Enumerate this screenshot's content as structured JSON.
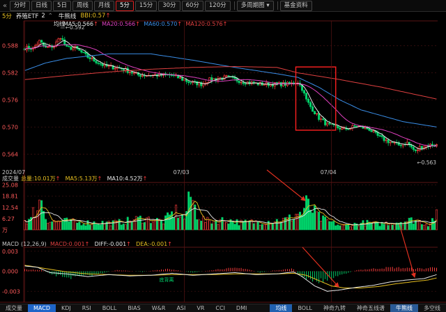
{
  "toolbar": {
    "back_glyph": "«",
    "buttons": [
      "分时",
      "日线",
      "5日",
      "周线",
      "月线",
      "5分",
      "15分",
      "30分",
      "60分",
      "120分"
    ],
    "active": "5分",
    "dropdown": "多周期图 ▾",
    "basic": "基金资料"
  },
  "info": {
    "period": "5分",
    "name": "养殖ETF",
    "count": "2",
    "toggle": "⌃",
    "indicator": "牛熊线",
    "bbi": "BBI:0.57",
    "bbi_arrow": "↑"
  },
  "chart_data": [
    {
      "type": "candlestick",
      "ma_legend": {
        "name": "均线"
      },
      "legend": [
        {
          "label": "MA5:0.566",
          "arrow": "↑",
          "color": "#e8e8e8"
        },
        {
          "label": "MA20:0.566",
          "arrow": "↑",
          "color": "#e040c0"
        },
        {
          "label": "MA60:0.570",
          "arrow": "↑",
          "color": "#3a8ee8"
        },
        {
          "label": "MA120:0.576",
          "arrow": "↑",
          "color": "#e04040"
        }
      ],
      "yticks": [
        "0.588",
        "0.582",
        "0.576",
        "0.570",
        "0.564"
      ],
      "ylim": [
        0.5605,
        0.5935
      ],
      "high_label": "0.592",
      "low_label": "0.563",
      "x_labels": [
        "2024/07",
        "07/03",
        "07/04"
      ],
      "x_label_pos": [
        0,
        76,
        146
      ],
      "n_bars": 197,
      "anchors": [
        [
          0,
          0.5875
        ],
        [
          4,
          0.5875
        ],
        [
          7,
          0.589
        ],
        [
          10,
          0.5875
        ],
        [
          14,
          0.588
        ],
        [
          17,
          0.59
        ],
        [
          20,
          0.5875
        ],
        [
          24,
          0.5875
        ],
        [
          30,
          0.5855
        ],
        [
          38,
          0.5835
        ],
        [
          46,
          0.583
        ],
        [
          54,
          0.5815
        ],
        [
          62,
          0.5815
        ],
        [
          70,
          0.5815
        ],
        [
          78,
          0.58
        ],
        [
          84,
          0.5795
        ],
        [
          88,
          0.5805
        ],
        [
          96,
          0.581
        ],
        [
          104,
          0.58
        ],
        [
          112,
          0.5795
        ],
        [
          120,
          0.5795
        ],
        [
          126,
          0.5795
        ],
        [
          130,
          0.58
        ],
        [
          132,
          0.5785
        ],
        [
          134,
          0.576
        ],
        [
          136,
          0.5745
        ],
        [
          140,
          0.572
        ],
        [
          144,
          0.5705
        ],
        [
          148,
          0.57
        ],
        [
          152,
          0.5695
        ],
        [
          158,
          0.5702
        ],
        [
          164,
          0.5695
        ],
        [
          168,
          0.568
        ],
        [
          172,
          0.567
        ],
        [
          178,
          0.566
        ],
        [
          182,
          0.5665
        ],
        [
          186,
          0.5645
        ],
        [
          188,
          0.5655
        ],
        [
          192,
          0.566
        ],
        [
          196,
          0.566
        ]
      ],
      "ma60": [
        [
          0,
          0.5825
        ],
        [
          10,
          0.5842
        ],
        [
          20,
          0.5852
        ],
        [
          40,
          0.5862
        ],
        [
          60,
          0.5862
        ],
        [
          80,
          0.5848
        ],
        [
          100,
          0.5832
        ],
        [
          120,
          0.5818
        ],
        [
          130,
          0.581
        ],
        [
          140,
          0.5788
        ],
        [
          150,
          0.576
        ],
        [
          160,
          0.5738
        ],
        [
          170,
          0.5725
        ],
        [
          180,
          0.5712
        ],
        [
          196,
          0.57
        ]
      ],
      "ma120": [
        [
          0,
          0.5805
        ],
        [
          20,
          0.5814
        ],
        [
          40,
          0.5822
        ],
        [
          60,
          0.5828
        ],
        [
          80,
          0.5832
        ],
        [
          100,
          0.5834
        ],
        [
          120,
          0.5832
        ],
        [
          130,
          0.582
        ],
        [
          150,
          0.5805
        ],
        [
          170,
          0.5788
        ],
        [
          196,
          0.5762
        ]
      ],
      "box": {
        "x0": 129,
        "x1": 148,
        "y0": 0.5833,
        "y1": 0.5693
      }
    },
    {
      "type": "bar",
      "title": "成交量",
      "legend": [
        {
          "label": "总量:10.01万",
          "arrow": "↑",
          "color": "#e8c020"
        },
        {
          "label": "MA5:5.13万",
          "arrow": "↑",
          "color": "#e8c020"
        },
        {
          "label": "MA10:4.52万",
          "arrow": "↑",
          "color": "#e8e8e8"
        }
      ],
      "yticks": [
        "25.08",
        "18.81",
        "12.54",
        "6.27",
        "万"
      ],
      "ylim": [
        0,
        26.5
      ],
      "peaks": [
        [
          3,
          7
        ],
        [
          4,
          12
        ],
        [
          6,
          16
        ],
        [
          8,
          22
        ],
        [
          10,
          9
        ],
        [
          12,
          6
        ],
        [
          20,
          6
        ],
        [
          26,
          5
        ],
        [
          44,
          5
        ],
        [
          56,
          8
        ],
        [
          66,
          6
        ],
        [
          72,
          13
        ],
        [
          76,
          8
        ],
        [
          79,
          24
        ],
        [
          82,
          11
        ],
        [
          86,
          6
        ],
        [
          96,
          7
        ],
        [
          103,
          5
        ],
        [
          116,
          6
        ],
        [
          124,
          7
        ],
        [
          128,
          9
        ],
        [
          130,
          12
        ],
        [
          132,
          11
        ],
        [
          134,
          18
        ],
        [
          136,
          15
        ],
        [
          138,
          12
        ],
        [
          140,
          9
        ],
        [
          142,
          7
        ],
        [
          144,
          6
        ],
        [
          150,
          3
        ],
        [
          158,
          4
        ],
        [
          162,
          5
        ],
        [
          168,
          4
        ],
        [
          174,
          5
        ],
        [
          180,
          6
        ],
        [
          186,
          7
        ],
        [
          192,
          4
        ],
        [
          196,
          10
        ]
      ]
    },
    {
      "type": "bar",
      "title": "MACD",
      "params": "(12,26,9)",
      "legend": [
        {
          "label": "MACD:0.001",
          "arrow": "↑",
          "color": "#e04040"
        },
        {
          "label": "DIFF:-0.001",
          "arrow": "↑",
          "color": "#e8e8e8"
        },
        {
          "label": "DEA:-0.001",
          "arrow": "↑",
          "color": "#e8c020"
        }
      ],
      "yticks": [
        "0.003",
        "0.000",
        "-0.003"
      ],
      "ylim": [
        -0.0036,
        0.0036
      ],
      "annotation": "底背离",
      "diff": [
        [
          0,
          0.0008
        ],
        [
          6,
          0.0006
        ],
        [
          12,
          -0.0002
        ],
        [
          20,
          -0.0004
        ],
        [
          30,
          -0.0008
        ],
        [
          40,
          -0.0005
        ],
        [
          50,
          -0.0007
        ],
        [
          60,
          -0.0006
        ],
        [
          70,
          -0.0003
        ],
        [
          80,
          -0.0006
        ],
        [
          90,
          -0.0004
        ],
        [
          100,
          -0.0002
        ],
        [
          110,
          -0.0005
        ],
        [
          120,
          -0.0004
        ],
        [
          128,
          -0.0001
        ],
        [
          132,
          -0.0008
        ],
        [
          138,
          -0.0022
        ],
        [
          144,
          -0.003
        ],
        [
          150,
          -0.0028
        ],
        [
          158,
          -0.0024
        ],
        [
          166,
          -0.0021
        ],
        [
          174,
          -0.0016
        ],
        [
          182,
          -0.0013
        ],
        [
          190,
          -0.0011
        ],
        [
          196,
          -0.0005
        ]
      ],
      "dea": [
        [
          0,
          0.0009
        ],
        [
          10,
          0.0004
        ],
        [
          20,
          -0.0001
        ],
        [
          30,
          -0.0004
        ],
        [
          40,
          -0.0005
        ],
        [
          50,
          -0.0006
        ],
        [
          60,
          -0.0006
        ],
        [
          70,
          -0.0005
        ],
        [
          80,
          -0.0005
        ],
        [
          90,
          -0.0005
        ],
        [
          100,
          -0.0004
        ],
        [
          110,
          -0.0004
        ],
        [
          120,
          -0.0004
        ],
        [
          128,
          -0.0003
        ],
        [
          134,
          -0.0006
        ],
        [
          140,
          -0.0014
        ],
        [
          146,
          -0.0022
        ],
        [
          152,
          -0.0025
        ],
        [
          160,
          -0.0025
        ],
        [
          168,
          -0.0023
        ],
        [
          176,
          -0.0019
        ],
        [
          184,
          -0.0016
        ],
        [
          192,
          -0.0013
        ],
        [
          196,
          -0.001
        ]
      ],
      "hist": [
        [
          0,
          0.0003
        ],
        [
          8,
          0.0002
        ],
        [
          14,
          -0.0006
        ],
        [
          22,
          -0.001
        ],
        [
          32,
          -0.0006
        ],
        [
          44,
          0.0002
        ],
        [
          56,
          -0.0001
        ],
        [
          68,
          0.0004
        ],
        [
          80,
          -0.0002
        ],
        [
          94,
          0.0004
        ],
        [
          104,
          0.0005
        ],
        [
          112,
          -0.0002
        ],
        [
          120,
          0.0002
        ],
        [
          128,
          0.0004
        ],
        [
          132,
          -0.001
        ],
        [
          138,
          -0.0016
        ],
        [
          144,
          -0.0014
        ],
        [
          150,
          -0.0006
        ],
        [
          158,
          0.0002
        ],
        [
          166,
          0.0004
        ],
        [
          174,
          0.0006
        ],
        [
          182,
          0.0005
        ],
        [
          190,
          0.0004
        ],
        [
          196,
          0.0007
        ]
      ]
    }
  ],
  "bottom_tabs": [
    "成交量",
    "MACD",
    "KDJ",
    "RSI",
    "BOLL",
    "BIAS",
    "W&R",
    "ASI",
    "VR",
    "CCI",
    "DMI"
  ],
  "bottom_active": "MACD",
  "bottom_right_tabs": [
    "均线",
    "BOLL",
    "神奇九转",
    "神奇五线谱",
    "牛熊线",
    "多空线"
  ],
  "bottom_right_active": [
    "均线",
    "牛熊线"
  ],
  "colors": {
    "up": "#ff3c3c",
    "down": "#00d26a",
    "grid": "#3a1010",
    "axis_text": "#c8c8c8",
    "box": "#ff2020",
    "arrow": "#e03020"
  }
}
